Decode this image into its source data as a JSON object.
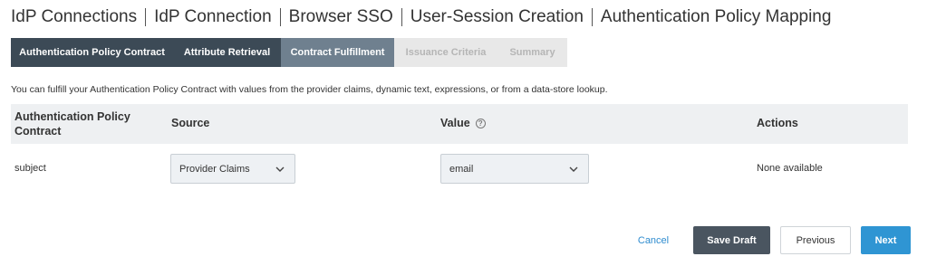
{
  "breadcrumb": [
    "IdP Connections",
    "IdP Connection",
    "Browser SSO",
    "User-Session Creation",
    "Authentication Policy Mapping"
  ],
  "tabs": [
    {
      "label": "Authentication Policy Contract",
      "state": "done"
    },
    {
      "label": "Attribute Retrieval",
      "state": "done"
    },
    {
      "label": "Contract Fulfillment",
      "state": "active"
    },
    {
      "label": "Issuance Criteria",
      "state": "pending"
    },
    {
      "label": "Summary",
      "state": "pending"
    }
  ],
  "intro": "You can fulfill your Authentication Policy Contract with values from the provider claims, dynamic text, expressions, or from a data-store lookup.",
  "table": {
    "headers": {
      "contract": "Authentication Policy Contract",
      "source": "Source",
      "value": "Value",
      "actions": "Actions"
    },
    "rows": [
      {
        "contract": "subject",
        "source": "Provider Claims",
        "value": "email",
        "actions": "None available"
      }
    ]
  },
  "buttons": {
    "cancel": "Cancel",
    "save_draft": "Save Draft",
    "previous": "Previous",
    "next": "Next"
  },
  "icons": {
    "help": "question-circle-icon",
    "dropdown": "chevron-down-icon"
  },
  "colors": {
    "tab_done": "#3c4a56",
    "tab_active": "#6f808f",
    "primary": "#2f95d3",
    "link": "#2e8ccf"
  }
}
